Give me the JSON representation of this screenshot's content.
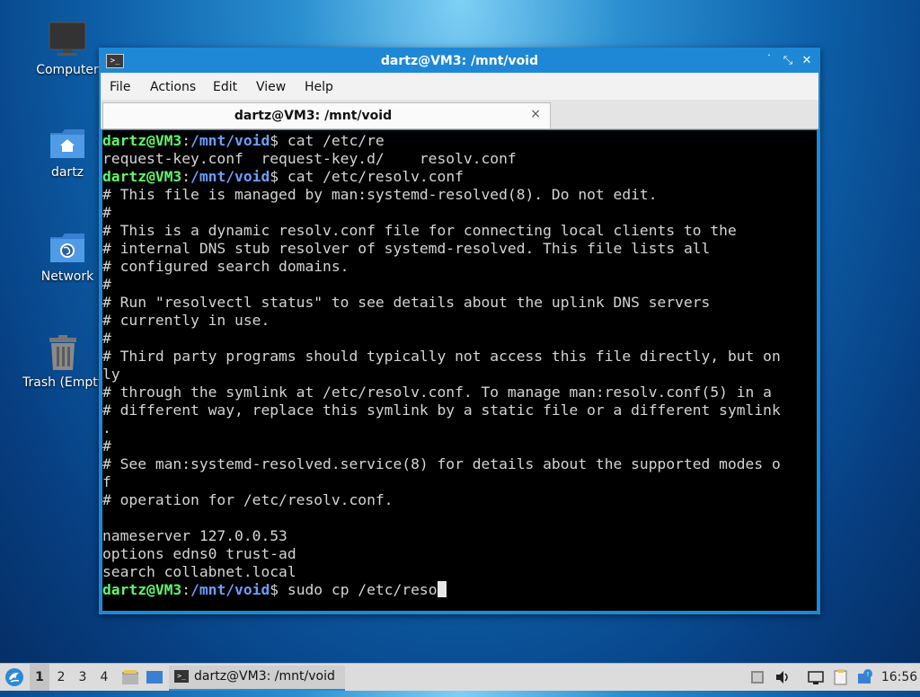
{
  "desktop": {
    "icons": [
      {
        "label": "Computer",
        "icon": "computer-icon"
      },
      {
        "label": "dartz",
        "icon": "home-folder-icon"
      },
      {
        "label": "Network",
        "icon": "network-folder-icon"
      },
      {
        "label": "Trash (Empty)",
        "icon": "trash-icon"
      }
    ]
  },
  "window": {
    "title": "dartz@VM3: /mnt/void",
    "menu": [
      "File",
      "Actions",
      "Edit",
      "View",
      "Help"
    ],
    "tab_title": "dartz@VM3: /mnt/void",
    "tab_close": "×",
    "controls": {
      "minimize": "˙",
      "maximize": "⤡",
      "close": "✕"
    }
  },
  "terminal": {
    "prompt_user": "dartz@VM3",
    "prompt_path": "/mnt/void",
    "lines": [
      {
        "type": "prompt",
        "cmd": "cat /etc/re"
      },
      {
        "type": "out",
        "text": "request-key.conf  request-key.d/    resolv.conf"
      },
      {
        "type": "prompt",
        "cmd": "cat /etc/resolv.conf"
      },
      {
        "type": "out",
        "text": "# This file is managed by man:systemd-resolved(8). Do not edit."
      },
      {
        "type": "out",
        "text": "#"
      },
      {
        "type": "out",
        "text": "# This is a dynamic resolv.conf file for connecting local clients to the"
      },
      {
        "type": "out",
        "text": "# internal DNS stub resolver of systemd-resolved. This file lists all"
      },
      {
        "type": "out",
        "text": "# configured search domains."
      },
      {
        "type": "out",
        "text": "#"
      },
      {
        "type": "out",
        "text": "# Run \"resolvectl status\" to see details about the uplink DNS servers"
      },
      {
        "type": "out",
        "text": "# currently in use."
      },
      {
        "type": "out",
        "text": "#"
      },
      {
        "type": "out",
        "text": "# Third party programs should typically not access this file directly, but on"
      },
      {
        "type": "out",
        "text": "ly"
      },
      {
        "type": "out",
        "text": "# through the symlink at /etc/resolv.conf. To manage man:resolv.conf(5) in a"
      },
      {
        "type": "out",
        "text": "# different way, replace this symlink by a static file or a different symlink"
      },
      {
        "type": "out",
        "text": "."
      },
      {
        "type": "out",
        "text": "#"
      },
      {
        "type": "out",
        "text": "# See man:systemd-resolved.service(8) for details about the supported modes o"
      },
      {
        "type": "out",
        "text": "f"
      },
      {
        "type": "out",
        "text": "# operation for /etc/resolv.conf."
      },
      {
        "type": "out",
        "text": ""
      },
      {
        "type": "out",
        "text": "nameserver 127.0.0.53"
      },
      {
        "type": "out",
        "text": "options edns0 trust-ad"
      },
      {
        "type": "out",
        "text": "search collabnet.local"
      },
      {
        "type": "prompt",
        "cmd": "sudo cp /etc/reso",
        "cursor": true
      }
    ]
  },
  "taskbar": {
    "workspaces": [
      "1",
      "2",
      "3",
      "4"
    ],
    "active_workspace": "1",
    "task_label": "dartz@VM3: /mnt/void",
    "clock": "16:56",
    "accent": "#2b8ad6"
  }
}
